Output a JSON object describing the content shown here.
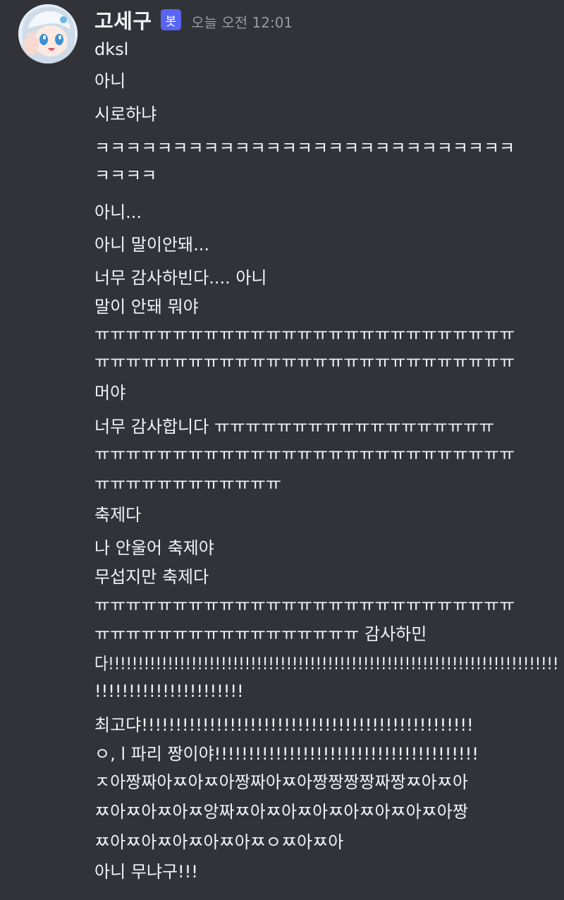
{
  "message": {
    "author": "고세구",
    "bot_tag": "봇",
    "timestamp": "오늘 오전 12:01",
    "lines": [
      "dksl",
      "아니",
      "시로하냐",
      "ㅋㅋㅋㅋㅋㅋㅋㅋㅋㅋㅋㅋㅋㅋㅋㅋㅋㅋㅋㅋㅋㅋㅋㅋㅋㅋㅋ",
      "ㅋㅋㅋㅋ",
      "아니...",
      "아니 말이안돼...",
      "너무 감사하빈다.... 아니",
      "말이 안돼 뭐야",
      "ㅠㅠㅠㅠㅠㅠㅠㅠㅠㅠㅠㅠㅠㅠㅠㅠㅠㅠㅠㅠㅠㅠㅠㅠㅠㅠㅠ",
      "ㅠㅠㅠㅠㅠㅠㅠㅠㅠㅠㅠㅠㅠㅠㅠㅠㅠㅠㅠㅠㅠㅠㅠㅠㅠㅠㅠ",
      "머야",
      "너무 감사합니다 ㅠㅠㅠㅠㅠㅠㅠㅠㅠㅠㅠㅠㅠㅠㅠㅠㅠㅠ",
      "ㅠㅠㅠㅠㅠㅠㅠㅠㅠㅠㅠㅠㅠㅠㅠㅠㅠㅠㅠㅠㅠㅠㅠㅠㅠㅠㅠ",
      "ㅠㅠㅠㅠㅠㅠㅠㅠㅠㅠㅠㅠ",
      "축제다",
      "나 안울어 축제야",
      "무섭지만 축제다",
      "ㅠㅠㅠㅠㅠㅠㅠㅠㅠㅠㅠㅠㅠㅠㅠㅠㅠㅠㅠㅠㅠㅠㅠㅠㅠㅠㅠ",
      "ㅠㅠㅠㅠㅠㅠㅠㅠㅠㅠㅠㅠㅠㅠㅠㅠㅠ 감사하민",
      "다!!!!!!!!!!!!!!!!!!!!!!!!!!!!!!!!!!!!!!!!!!!!!!!!!!!!!!!!!!!!!!!!!!!!!!!!!!!!",
      "!!!!!!!!!!!!!!!!!!!!!!",
      "최고댜!!!!!!!!!!!!!!!!!!!!!!!!!!!!!!!!!!!!!!!!!!!!!!!!!",
      "ㅇ, l 파리 짱이야!!!!!!!!!!!!!!!!!!!!!!!!!!!!!!!!!!!!!!!",
      "ㅈ아짱짜아ㅉ아ㅉ아짱짜아ㅉ아짱짱짱짱짜짱ㅉ아ㅉ아",
      "ㅉ아ㅉ아ㅉ아ㅉ앙짜ㅉ아ㅉ아ㅉ아ㅉ아ㅉ아ㅉ아ㅉ아짱",
      "ㅉ아ㅉ아ㅉ아ㅉ아ㅉ아ㅉㅇㅉ아ㅉ아",
      "아니 무냐구!!!"
    ]
  },
  "colors": {
    "background": "#313338",
    "text": "#f2f3f5",
    "timestamp": "#949ba4",
    "bot_tag": "#5865f2"
  }
}
